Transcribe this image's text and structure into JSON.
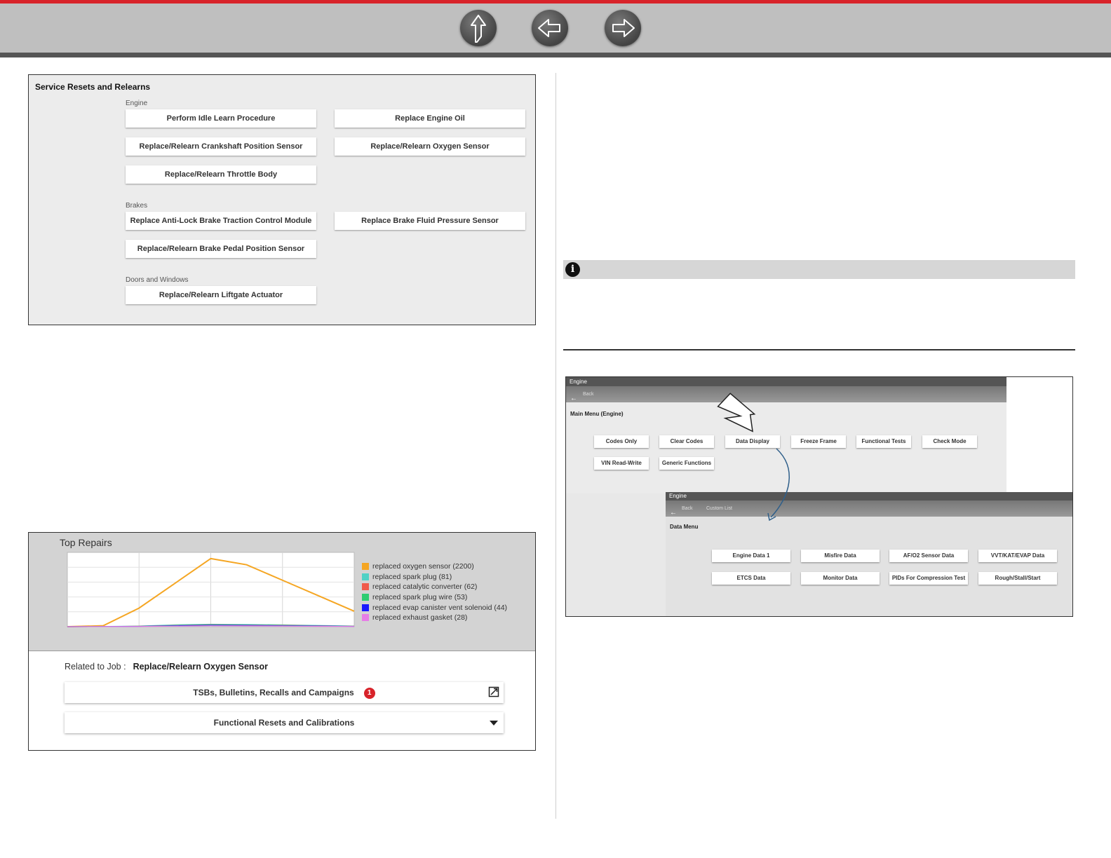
{
  "nav": {
    "up_icon": "up-arrow-icon",
    "back_icon": "left-arrow-icon",
    "forward_icon": "right-arrow-icon"
  },
  "service_resets": {
    "title": "Service Resets and Relearns",
    "sections": [
      {
        "label": "Engine",
        "buttons": [
          "Perform Idle Learn Procedure",
          "Replace Engine Oil",
          "Replace/Relearn Crankshaft Position Sensor",
          "Replace/Relearn Oxygen Sensor",
          "Replace/Relearn Throttle Body"
        ]
      },
      {
        "label": "Brakes",
        "buttons": [
          "Replace Anti-Lock Brake Traction Control Module",
          "Replace Brake Fluid Pressure Sensor",
          "Replace/Relearn Brake Pedal Position Sensor"
        ]
      },
      {
        "label": "Doors and Windows",
        "buttons": [
          "Replace/Relearn Liftgate Actuator"
        ]
      }
    ]
  },
  "top_repairs": {
    "title": "Top Repairs",
    "related_label": "Related to Job :",
    "related_job": "Replace/Relearn Oxygen Sensor",
    "tsb_label": "TSBs, Bulletins, Recalls and Campaigns",
    "tsb_count": "1",
    "functional_label": "Functional Resets and Calibrations"
  },
  "chart_data": {
    "type": "line",
    "title": "Top Repairs",
    "x": [
      0,
      25,
      50,
      75,
      100,
      125,
      150,
      175,
      200
    ],
    "xlim": [
      0,
      200
    ],
    "ylim": [
      0,
      2400
    ],
    "ytick_count": 6,
    "xtick_count": 5,
    "grid": true,
    "legend_position": "right",
    "series": [
      {
        "name": "replaced oxygen sensor (2200)",
        "color": "#f5a623",
        "values": [
          0,
          30,
          600,
          1400,
          2200,
          2000,
          1500,
          1000,
          500
        ]
      },
      {
        "name": "replaced spark plug (81)",
        "color": "#4fd1c5",
        "values": [
          0,
          5,
          20,
          60,
          81,
          70,
          60,
          40,
          20
        ]
      },
      {
        "name": "replaced catalytic converter (62)",
        "color": "#f05a4a",
        "values": [
          0,
          4,
          15,
          40,
          62,
          55,
          45,
          30,
          15
        ]
      },
      {
        "name": "replaced spark plug wire (53)",
        "color": "#2ecc71",
        "values": [
          0,
          3,
          12,
          35,
          53,
          48,
          38,
          25,
          12
        ]
      },
      {
        "name": "replaced evap canister vent solenoid (44)",
        "color": "#1a1aff",
        "values": [
          0,
          2,
          10,
          30,
          44,
          40,
          30,
          20,
          10
        ]
      },
      {
        "name": "replaced exhaust gasket (28)",
        "color": "#e67ee6",
        "values": [
          0,
          2,
          6,
          18,
          28,
          25,
          20,
          12,
          6
        ]
      }
    ]
  },
  "engine_figure": {
    "window1": {
      "title": "Engine",
      "back": "Back",
      "header": "Main Menu (Engine)",
      "buttons": [
        "Codes Only",
        "Clear Codes",
        "Data Display",
        "Freeze Frame",
        "Functional Tests",
        "Check Mode",
        "VIN Read-Write",
        "Generic Functions"
      ]
    },
    "window2": {
      "title": "Engine",
      "back": "Back",
      "custom": "Custom List",
      "header": "Data Menu",
      "buttons": [
        "Engine Data 1",
        "Misfire Data",
        "AF/O2 Sensor Data",
        "VVT/KAT/EVAP Data",
        "ETCS Data",
        "Monitor Data",
        "PIDs For Compression Test",
        "Rough/Stall/Start"
      ]
    }
  }
}
